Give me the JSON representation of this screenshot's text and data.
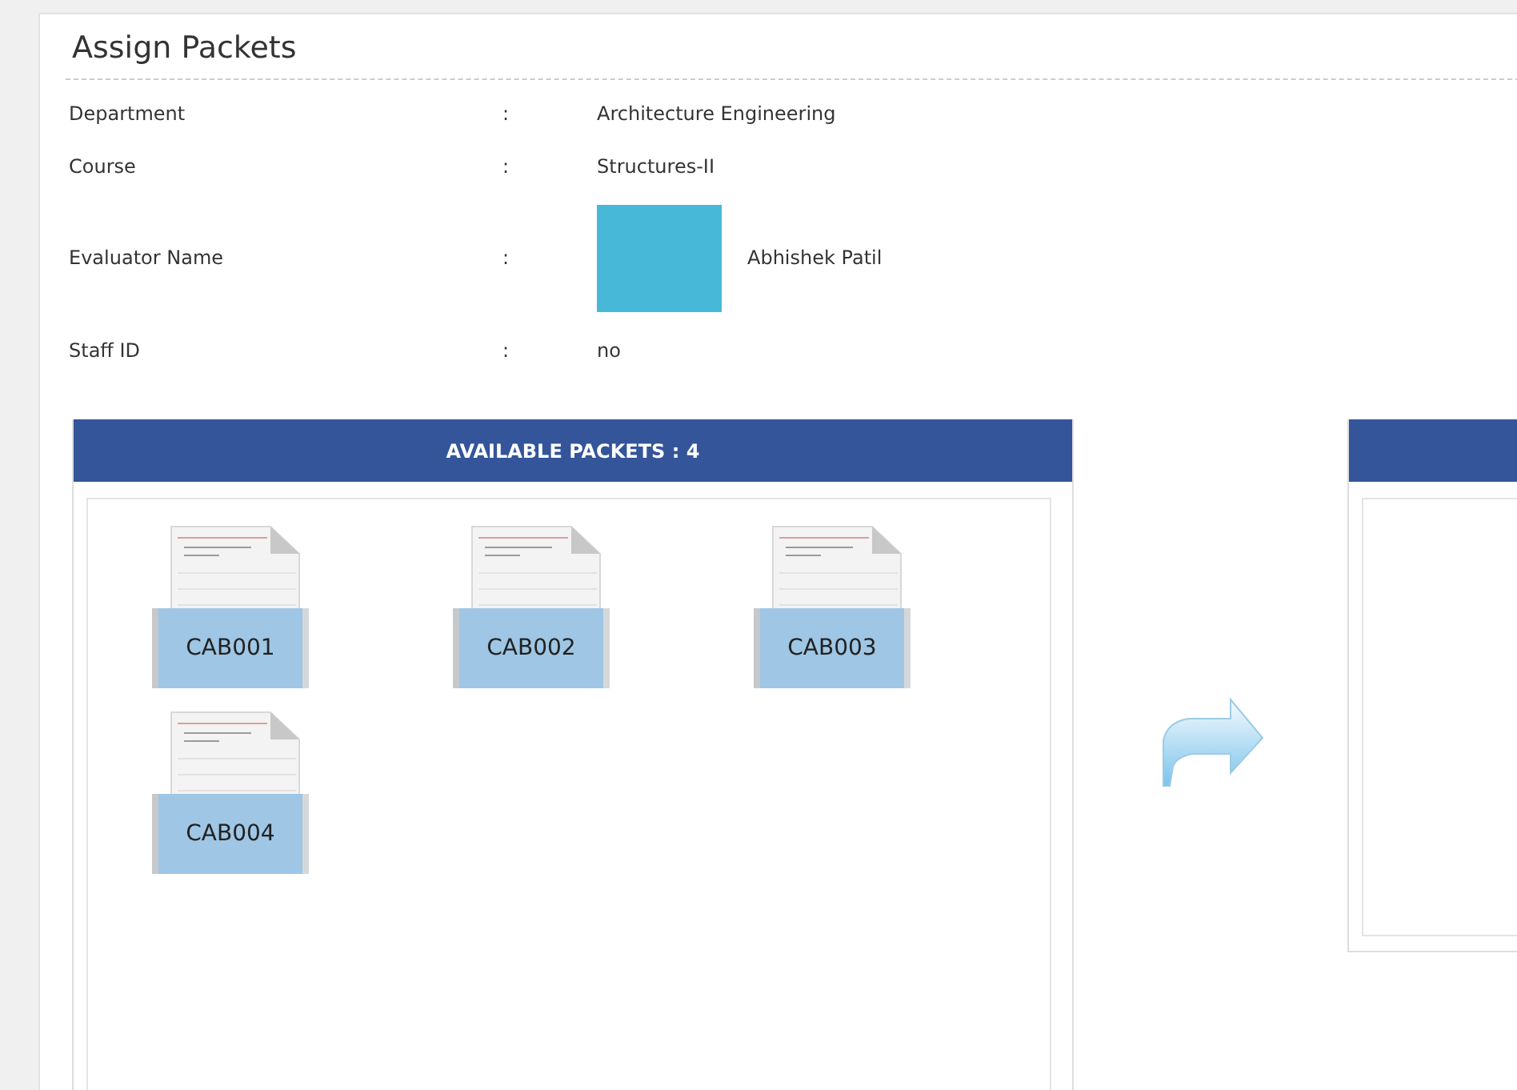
{
  "title": "Assign Packets",
  "details": [
    {
      "kind": "text",
      "label": "Department",
      "separator": ":",
      "value": "Architecture Engineering"
    },
    {
      "kind": "text",
      "label": "Course",
      "separator": ":",
      "value": "Structures-II"
    },
    {
      "kind": "photo",
      "label": "Evaluator Name",
      "separator": ":",
      "value": "Abhishek Patil"
    },
    {
      "kind": "text",
      "label": "Staff ID",
      "separator": ":",
      "value": "no"
    }
  ],
  "available_panel": {
    "header": "AVAILABLE PACKETS : 4",
    "packets": [
      {
        "label": "CAB001"
      },
      {
        "label": "CAB002"
      },
      {
        "label": "CAB003"
      },
      {
        "label": "CAB004"
      }
    ]
  }
}
